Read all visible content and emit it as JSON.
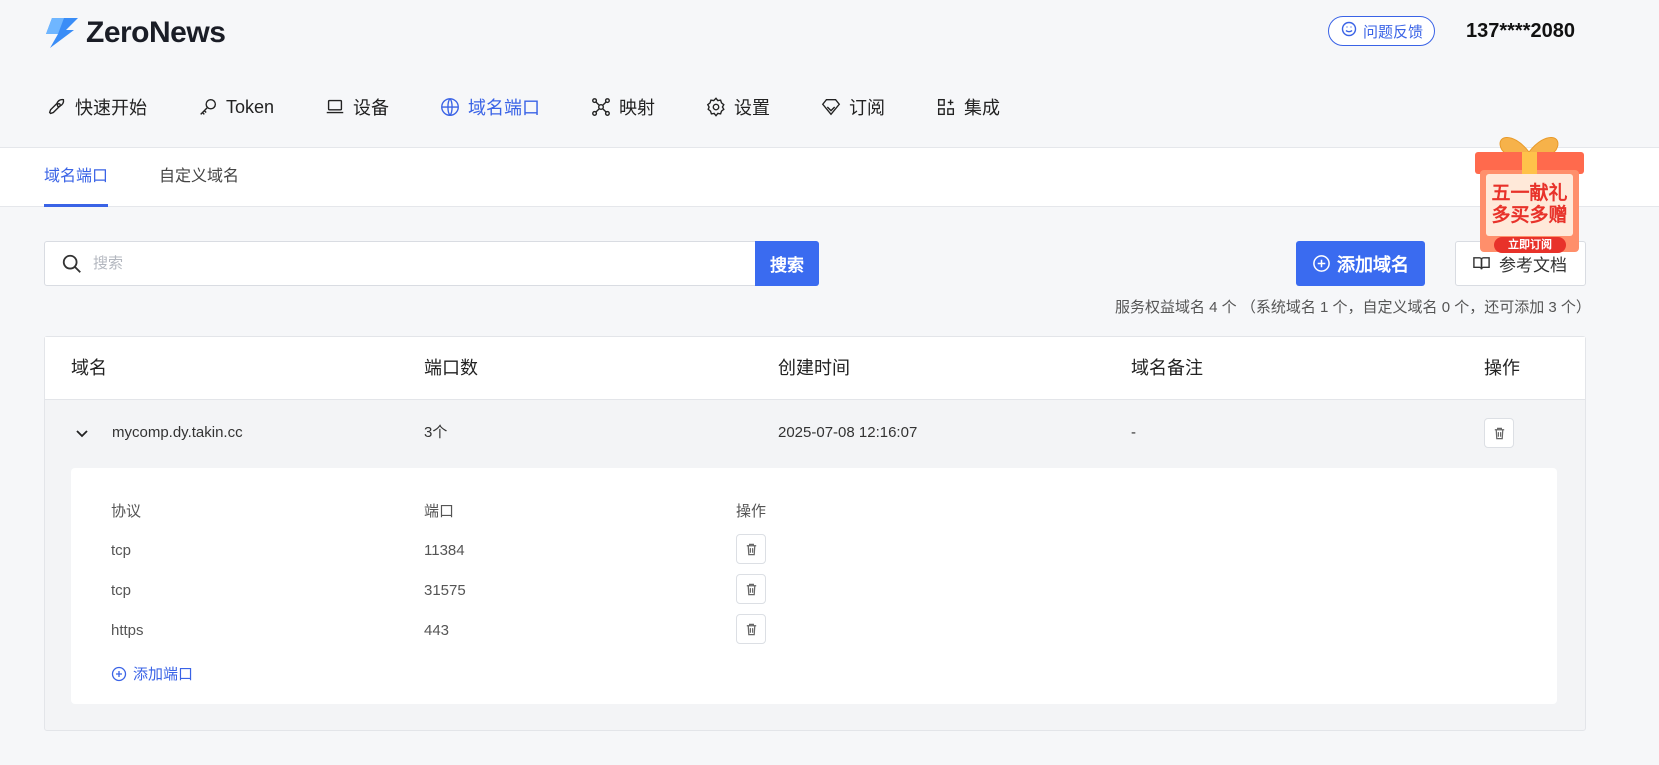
{
  "app": {
    "name": "ZeroNews"
  },
  "header": {
    "feedback_label": "问题反馈",
    "user_phone": "137****2080"
  },
  "nav": [
    {
      "label": "快速开始",
      "icon": "rocket-icon"
    },
    {
      "label": "Token",
      "icon": "key-icon"
    },
    {
      "label": "设备",
      "icon": "laptop-icon"
    },
    {
      "label": "域名端口",
      "icon": "globe-icon",
      "active": true
    },
    {
      "label": "映射",
      "icon": "network-icon"
    },
    {
      "label": "设置",
      "icon": "gear-icon"
    },
    {
      "label": "订阅",
      "icon": "diamond-icon"
    },
    {
      "label": "集成",
      "icon": "apps-icon"
    }
  ],
  "subtabs": [
    {
      "label": "域名端口",
      "active": true
    },
    {
      "label": "自定义域名"
    }
  ],
  "search": {
    "placeholder": "搜索",
    "button": "搜索"
  },
  "actions": {
    "add_domain": "添加域名",
    "docs": "参考文档"
  },
  "quota_text": "服务权益域名 4 个 （系统域名 1 个，自定义域名 0 个，还可添加 3 个）",
  "promo": {
    "line1": "五一献礼",
    "line2": "多买多赠",
    "cta": "立即订阅"
  },
  "table": {
    "headers": [
      "域名",
      "端口数",
      "创建时间",
      "域名备注",
      "操作"
    ],
    "rows": [
      {
        "domain": "mycomp.dy.takin.cc",
        "port_count": "3个",
        "created": "2025-07-08 12:16:07",
        "note": "-",
        "expanded": true,
        "ports_headers": [
          "协议",
          "端口",
          "操作"
        ],
        "ports": [
          {
            "protocol": "tcp",
            "port": "11384"
          },
          {
            "protocol": "tcp",
            "port": "31575"
          },
          {
            "protocol": "https",
            "port": "443"
          }
        ],
        "add_port_label": "添加端口"
      }
    ]
  },
  "colors": {
    "accent": "#3a63e6",
    "primary_button": "#3a6bf0"
  }
}
